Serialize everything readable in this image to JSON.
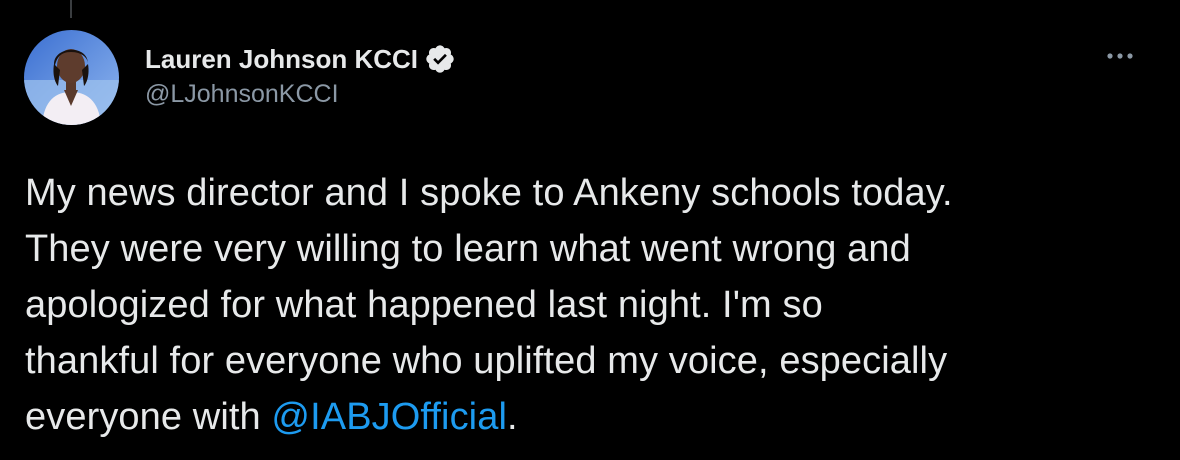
{
  "tweet": {
    "author": {
      "display_name": "Lauren Johnson KCCI",
      "handle": "@LJohnsonKCCI",
      "verified": true
    },
    "text_lines": [
      "My news director and I spoke to Ankeny schools today.",
      "They were very willing to learn what went wrong and",
      "apologized for what happened last night. I'm so",
      "thankful for everyone who uplifted my voice, especially"
    ],
    "last_line_prefix": "everyone with ",
    "mention": "@IABJOfficial",
    "last_line_suffix": "."
  },
  "icons": {
    "verified": "verified-badge-icon",
    "more": "more-options-icon"
  },
  "colors": {
    "background": "#000000",
    "text": "#e7e9ea",
    "secondary": "#8b98a5",
    "accent": "#1d9bf0"
  }
}
